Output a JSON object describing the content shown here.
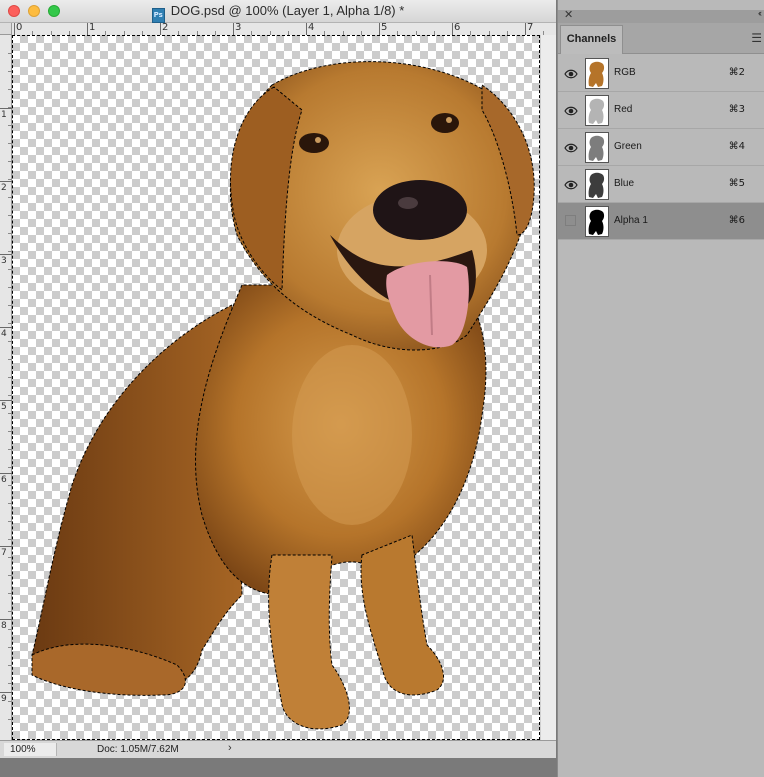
{
  "window": {
    "title": "DOG.psd @ 100% (Layer 1, Alpha 1/8) *",
    "file_icon": "ps-file-icon"
  },
  "ruler": {
    "horizontal_labels": [
      "0",
      "1",
      "2",
      "3",
      "4",
      "5",
      "6",
      "7"
    ],
    "vertical_labels": [
      "1",
      "2",
      "3",
      "4",
      "5",
      "6",
      "7",
      "8",
      "9"
    ]
  },
  "status": {
    "zoom": "100%",
    "doc_size": "Doc: 1.05M/7.62M",
    "arrow": "›"
  },
  "panel": {
    "tab_label": "Channels",
    "menu_icon": "panel-menu-icon",
    "channels": [
      {
        "name": "RGB",
        "shortcut": "⌘2",
        "visible": true,
        "thumb": "color",
        "selected": false
      },
      {
        "name": "Red",
        "shortcut": "⌘3",
        "visible": true,
        "thumb": "light-gray",
        "selected": false
      },
      {
        "name": "Green",
        "shortcut": "⌘4",
        "visible": true,
        "thumb": "mid-gray",
        "selected": false
      },
      {
        "name": "Blue",
        "shortcut": "⌘5",
        "visible": true,
        "thumb": "dark-gray",
        "selected": false
      },
      {
        "name": "Alpha 1",
        "shortcut": "⌘6",
        "visible": false,
        "thumb": "silhouette",
        "selected": true
      }
    ]
  },
  "colors": {
    "dog_fur": "#b8772a",
    "panel_bg": "#b9b9b9",
    "active_row": "#8e8e8e"
  }
}
